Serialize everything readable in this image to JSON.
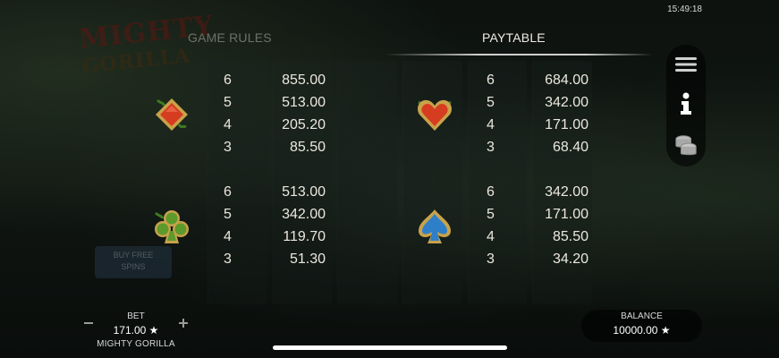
{
  "status_bar": {
    "time": "15:49:18"
  },
  "tabs": {
    "game_rules": "GAME RULES",
    "paytable": "PAYTABLE"
  },
  "side_menu": {
    "items": [
      {
        "icon": "hamburger-menu-icon"
      },
      {
        "icon": "info-icon"
      },
      {
        "icon": "coin-stack-icon"
      }
    ]
  },
  "paytable": {
    "diamond": {
      "symbol": "diamond-icon",
      "color": "#d63c20",
      "rows": [
        {
          "count": "6",
          "value": "855.00"
        },
        {
          "count": "5",
          "value": "513.00"
        },
        {
          "count": "4",
          "value": "205.20"
        },
        {
          "count": "3",
          "value": "85.50"
        }
      ]
    },
    "heart": {
      "symbol": "heart-icon",
      "color": "#d63c20",
      "rows": [
        {
          "count": "6",
          "value": "684.00"
        },
        {
          "count": "5",
          "value": "342.00"
        },
        {
          "count": "4",
          "value": "171.00"
        },
        {
          "count": "3",
          "value": "68.40"
        }
      ]
    },
    "club": {
      "symbol": "club-icon",
      "color": "#5c9a2c",
      "rows": [
        {
          "count": "6",
          "value": "513.00"
        },
        {
          "count": "5",
          "value": "342.00"
        },
        {
          "count": "4",
          "value": "119.70"
        },
        {
          "count": "3",
          "value": "51.30"
        }
      ]
    },
    "spade": {
      "symbol": "spade-icon",
      "color": "#2f7fc8",
      "rows": [
        {
          "count": "6",
          "value": "342.00"
        },
        {
          "count": "5",
          "value": "171.00"
        },
        {
          "count": "4",
          "value": "85.50"
        },
        {
          "count": "3",
          "value": "34.20"
        }
      ]
    }
  },
  "bet": {
    "label": "BET",
    "value": "171.00 ★",
    "minus_icon": "minus-icon",
    "plus_icon": "plus-icon"
  },
  "game_name": "MIGHTY GORILLA",
  "balance": {
    "label": "BALANCE",
    "value": "10000.00 ★"
  },
  "colors": {
    "frame_gold": "#c8a24a",
    "leaf_green": "#3e7a22"
  }
}
